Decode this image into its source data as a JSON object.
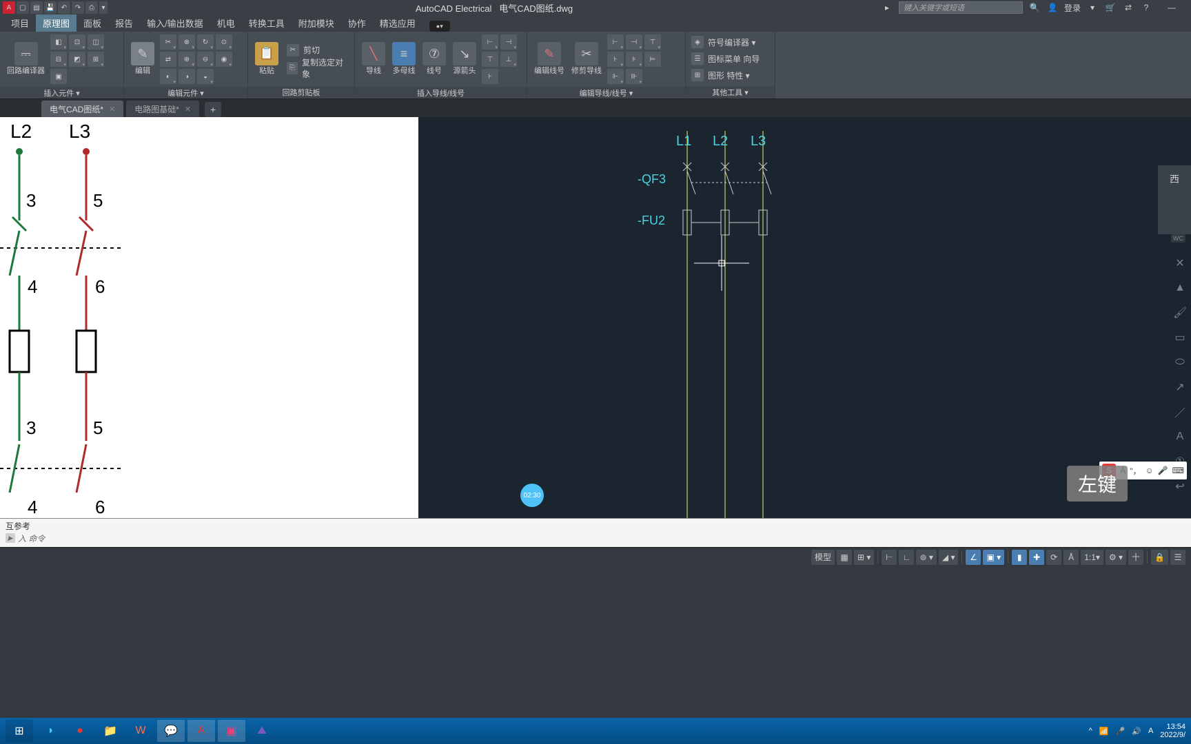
{
  "title": {
    "app": "AutoCAD Electrical",
    "file": "电气CAD图纸.dwg",
    "search_placeholder": "键入关键字或短语",
    "login": "登录"
  },
  "ribbon_tabs": [
    "项目",
    "原理图",
    "面板",
    "报告",
    "输入/输出数据",
    "机电",
    "转换工具",
    "附加模块",
    "协作",
    "精选应用"
  ],
  "panels": {
    "p0": {
      "title": "插入元件 ▾",
      "big": "回路编译器"
    },
    "p1": {
      "title": "编辑元件 ▾",
      "big": "编辑"
    },
    "p2": {
      "title": "回路剪贴板",
      "big": "粘贴",
      "items": [
        "剪切",
        "复制选定对象"
      ]
    },
    "p3": {
      "title": "插入导线/线号",
      "b1": "导线",
      "b2": "多母线",
      "b3": "线号",
      "b4": "源箭头"
    },
    "p4": {
      "title": "编辑导线/线号 ▾",
      "b1": "编辑线号",
      "b2": "修剪导线"
    },
    "p5": {
      "title": "其他工具 ▾",
      "r1": "符号编译器 ▾",
      "r2": "图标菜单 向导",
      "r3": "图形 特性 ▾"
    }
  },
  "doc_tabs": {
    "t0": "电气CAD图纸*",
    "t1": "电路图基础*",
    "add": "+"
  },
  "ref": {
    "L2": "L2",
    "L3": "L3",
    "n3a": "3",
    "n5a": "5",
    "n4a": "4",
    "n6a": "6",
    "n3b": "3",
    "n5b": "5",
    "n4b": "4",
    "n6b": "6"
  },
  "drawing": {
    "L1": "L1",
    "L2": "L2",
    "L3": "L3",
    "QF3": "-QF3",
    "FU2": "-FU2"
  },
  "nav": {
    "face": "西",
    "wcs": "WC"
  },
  "video_time": "02:30",
  "overlay_key": "左键",
  "ime_letter": "S",
  "ime_text": "A",
  "cmd": {
    "line1": "互参考",
    "line2": "入 命令"
  },
  "status": {
    "model": "模型",
    "ratio": "1:1",
    "count": "十"
  },
  "taskbar": {
    "time": "13:54",
    "date": "2022/9/"
  }
}
